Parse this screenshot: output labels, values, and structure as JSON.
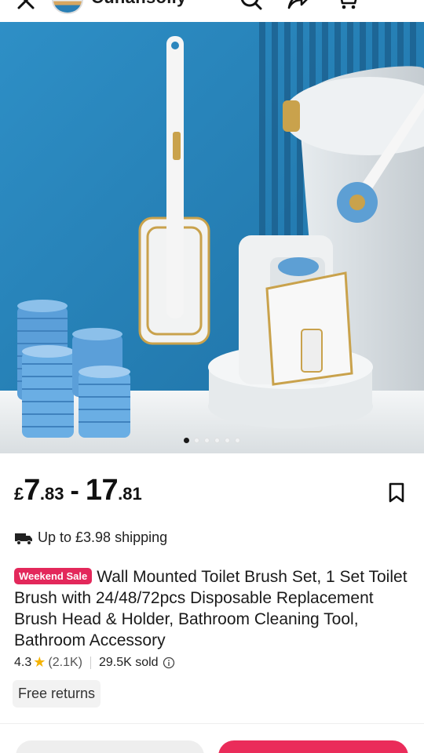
{
  "header": {
    "store_name": "Cuhansolly",
    "icons": [
      "close-icon",
      "search-icon",
      "share-icon",
      "cart-icon"
    ]
  },
  "gallery": {
    "image_description": "",
    "page_count": 6,
    "active_index": 0
  },
  "price": {
    "currency": "£",
    "min_whole": "7",
    "min_fraction": ".83",
    "separator": "-",
    "max_whole": "17",
    "max_fraction": ".81"
  },
  "shipping": {
    "icon": "truck-icon",
    "text": "Up to £3.98 shipping"
  },
  "product": {
    "badge": "Weekend Sale",
    "title": "Wall Mounted Toilet Brush Set, 1 Set Toilet Brush with 24/48/72pcs Disposable Replacement Brush Head & Holder, Bathroom Cleaning Tool, Bathroom Accessory"
  },
  "stats": {
    "rating": "4.3",
    "reviews": "(2.1K)",
    "sold": "29.5K sold"
  },
  "tags": {
    "returns": "Free returns"
  },
  "colors": {
    "accent": "#ea2c5a",
    "badge": "#e3285b",
    "star": "#f5b301",
    "background_blue": "#2c86bd"
  }
}
